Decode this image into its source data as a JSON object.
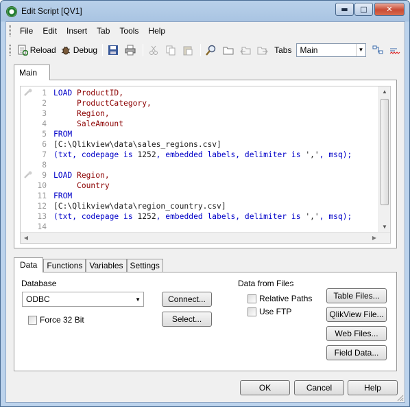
{
  "window": {
    "title": "Edit Script [QV1]",
    "minimize": "▬",
    "maximize": "□",
    "close": "✕"
  },
  "menu": [
    "File",
    "Edit",
    "Insert",
    "Tab",
    "Tools",
    "Help"
  ],
  "toolbar": {
    "reload": "Reload",
    "debug": "Debug",
    "tabs_label": "Tabs",
    "tabs_value": "Main"
  },
  "editor_tab": "Main",
  "script_lines": [
    {
      "n": "1",
      "parts": [
        [
          "kw",
          "LOAD "
        ],
        [
          "fld",
          "ProductID,"
        ]
      ]
    },
    {
      "n": "2",
      "parts": [
        [
          "",
          "     "
        ],
        [
          "fld",
          "ProductCategory,"
        ]
      ]
    },
    {
      "n": "3",
      "parts": [
        [
          "",
          "     "
        ],
        [
          "fld",
          "Region,"
        ]
      ]
    },
    {
      "n": "4",
      "parts": [
        [
          "",
          "     "
        ],
        [
          "fld",
          "SaleAmount"
        ]
      ]
    },
    {
      "n": "5",
      "parts": [
        [
          "kw",
          "FROM"
        ]
      ]
    },
    {
      "n": "6",
      "parts": [
        [
          "ptext",
          "[C:\\Qlikview\\data\\sales_regions.csv]"
        ]
      ]
    },
    {
      "n": "7",
      "parts": [
        [
          "kw",
          "("
        ],
        [
          "kw",
          "txt"
        ],
        [
          "kw",
          ", "
        ],
        [
          "kw",
          "codepage is "
        ],
        [
          "ptext",
          "1252"
        ],
        [
          "kw",
          ", embedded labels, delimiter is "
        ],
        [
          "ptext",
          "','"
        ],
        [
          "kw",
          ", "
        ],
        [
          "kw",
          "msq"
        ],
        [
          "kw",
          ");"
        ]
      ]
    },
    {
      "n": "8",
      "parts": []
    },
    {
      "n": "9",
      "parts": [
        [
          "kw",
          "LOAD "
        ],
        [
          "fld",
          "Region,"
        ]
      ]
    },
    {
      "n": "10",
      "parts": [
        [
          "",
          "     "
        ],
        [
          "fld",
          "Country"
        ]
      ]
    },
    {
      "n": "11",
      "parts": [
        [
          "kw",
          "FROM"
        ]
      ]
    },
    {
      "n": "12",
      "parts": [
        [
          "ptext",
          "[C:\\Qlikview\\data\\region_country.csv]"
        ]
      ]
    },
    {
      "n": "13",
      "parts": [
        [
          "kw",
          "("
        ],
        [
          "kw",
          "txt"
        ],
        [
          "kw",
          ", "
        ],
        [
          "kw",
          "codepage is "
        ],
        [
          "ptext",
          "1252"
        ],
        [
          "kw",
          ", embedded labels, delimiter is "
        ],
        [
          "ptext",
          "','"
        ],
        [
          "kw",
          ", "
        ],
        [
          "kw",
          "msq"
        ],
        [
          "kw",
          ");"
        ]
      ]
    },
    {
      "n": "14",
      "parts": []
    }
  ],
  "lower_tabs": [
    "Data",
    "Functions",
    "Variables",
    "Settings"
  ],
  "database": {
    "label": "Database",
    "selected": "ODBC",
    "connect": "Connect...",
    "select": "Select...",
    "force32": "Force 32 Bit"
  },
  "files": {
    "label": "Data from Files",
    "relative_paths": "Relative Paths",
    "use_ftp": "Use FTP",
    "table_files": "Table Files...",
    "qlikview_file": "QlikView File...",
    "web_files": "Web Files...",
    "field_data": "Field Data..."
  },
  "footer": {
    "ok": "OK",
    "cancel": "Cancel",
    "help": "Help"
  }
}
